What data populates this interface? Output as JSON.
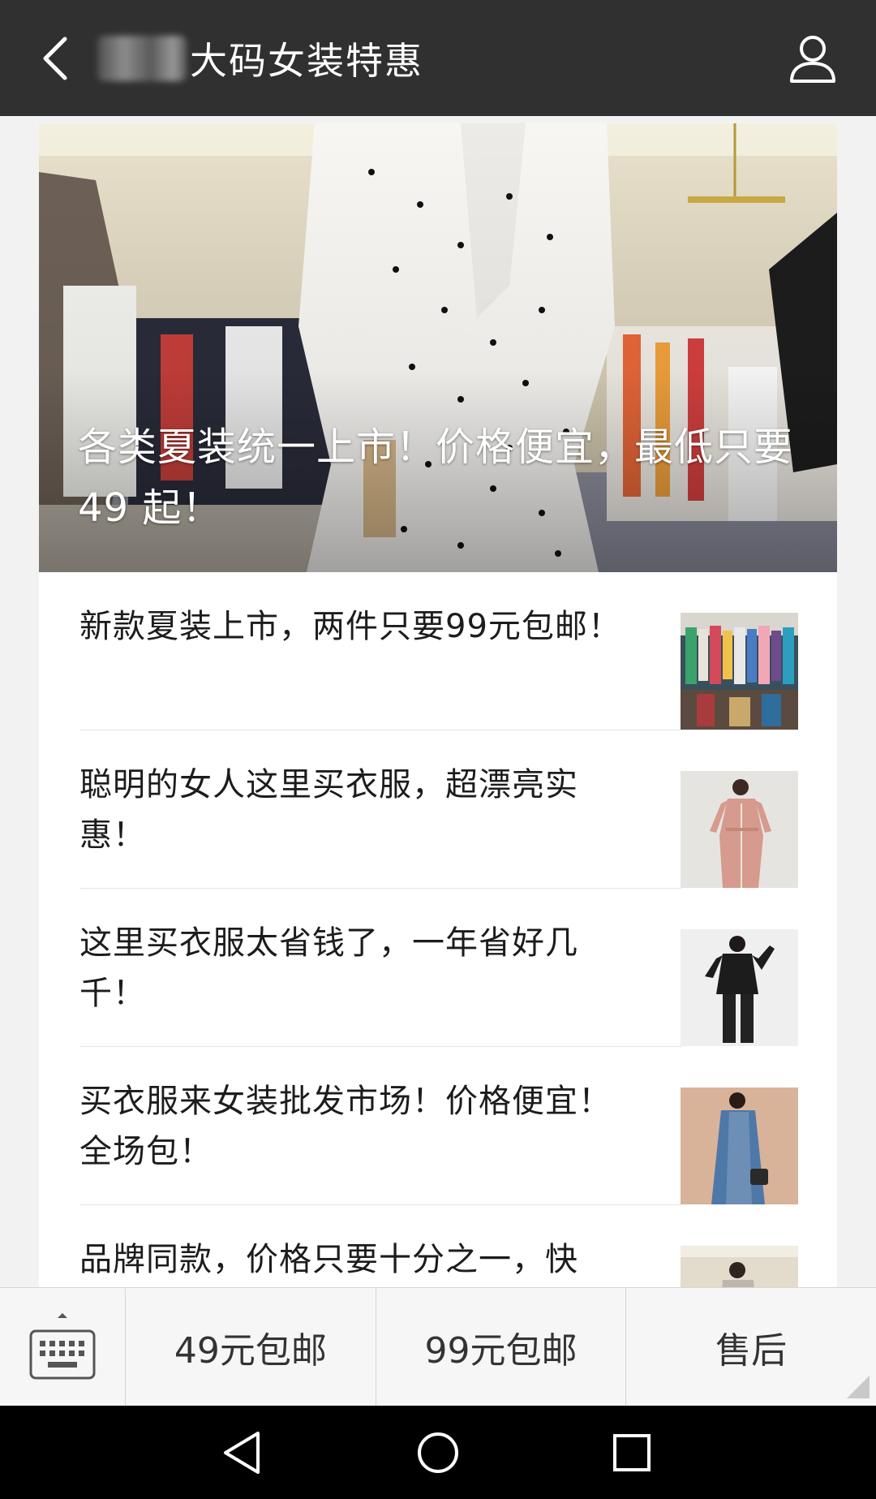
{
  "header": {
    "title": "大码女装特惠",
    "back_icon": "chevron-left-icon",
    "profile_icon": "person-icon"
  },
  "hero": {
    "title": "各类夏装统一上市！价格便宜，最低只要 49 起！"
  },
  "articles": [
    {
      "title": "新款夏装上市，两件只要99元包邮！"
    },
    {
      "title": "聪明的女人这里买衣服，超漂亮实惠！"
    },
    {
      "title": "这里买衣服太省钱了，一年省好几千！"
    },
    {
      "title": "买衣服来女装批发市场！价格便宜！全场包！"
    },
    {
      "title": "品牌同款，价格只要十分之一，快"
    }
  ],
  "menu": {
    "keyboard_icon": "keyboard-icon",
    "items": [
      {
        "label": "49元包邮"
      },
      {
        "label": "99元包邮"
      },
      {
        "label": "售后"
      }
    ]
  },
  "system_nav": {
    "back_icon": "triangle-back-icon",
    "home_icon": "circle-home-icon",
    "recents_icon": "square-recents-icon"
  },
  "colors": {
    "topbar": "#303030",
    "page_background": "#f2f2f2",
    "card": "#ffffff",
    "menu_bar": "#f6f6f6",
    "nav_bar": "#000000"
  }
}
